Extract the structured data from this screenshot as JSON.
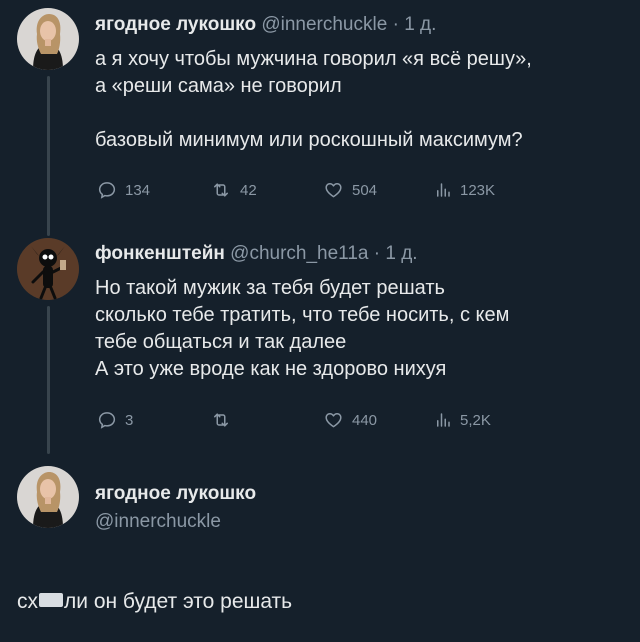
{
  "tweets": [
    {
      "name": "ягодное лукошко",
      "handle": "@innerchuckle",
      "separator": "·",
      "time": "1 д.",
      "lines": [
        "а я хочу чтобы мужчина говорил «я всё решу»,",
        "а «реши сама» не говорил",
        "",
        "базовый минимум или роскошный максимум?"
      ],
      "stats": {
        "replies": "134",
        "retweets": "42",
        "likes": "504",
        "views": "123K"
      }
    },
    {
      "name": "фонкенштейн",
      "handle": "@church_he11a",
      "separator": "·",
      "time": "1 д.",
      "lines": [
        "Но такой мужик за тебя будет решать",
        "сколько тебе тратить, что тебе носить, с кем",
        "тебе общаться и так далее",
        "А это уже вроде как не здорово нихуя"
      ],
      "stats": {
        "replies": "3",
        "retweets": "",
        "likes": "440",
        "views": "5,2K"
      }
    },
    {
      "name": "ягодное лукошко",
      "handle": "@innerchuckle",
      "text_before": "сх",
      "text_after": "ли он будет это решать"
    }
  ],
  "icons": {
    "reply": "reply-icon",
    "retweet": "retweet-icon",
    "like": "heart-icon",
    "views": "views-icon"
  },
  "colors": {
    "background": "#15202b",
    "text": "#e7e9ea",
    "muted": "#8b98a5",
    "thread_line": "#38444d"
  }
}
